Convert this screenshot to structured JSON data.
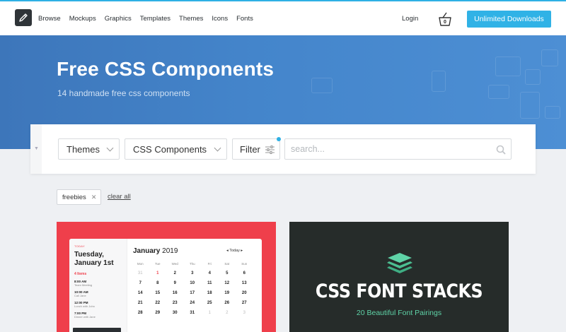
{
  "nav": {
    "items": [
      "Browse",
      "Mockups",
      "Graphics",
      "Templates",
      "Themes",
      "Icons",
      "Fonts"
    ],
    "login": "Login",
    "cart_count": "0",
    "unlimited_label": "Unlimited Downloads"
  },
  "hero": {
    "title": "Free CSS Components",
    "subtitle": "14 handmade free css components"
  },
  "filters": {
    "category": "Themes",
    "subcategory": "CSS Components",
    "filter_label": "Filter",
    "search_placeholder": "search..."
  },
  "tags": {
    "active": "freebies",
    "clear_label": "clear all"
  },
  "cards": [
    {
      "calendar": {
        "today_label": "TODAY",
        "day": "Tuesday,",
        "date": "January 1st",
        "items_label": "4 Items",
        "events": [
          {
            "time": "8:00 AM",
            "name": "Team Meeting"
          },
          {
            "time": "10:00 AM",
            "name": "Call Jane"
          },
          {
            "time": "12:00 PM",
            "name": "Lunch with John"
          },
          {
            "time": "7:00 PM",
            "name": "Dinner with Jane"
          }
        ],
        "month": "January",
        "year": "2019",
        "today_btn": "Today",
        "weekdays": [
          "Mon",
          "Tue",
          "Wed",
          "Thu",
          "Fri",
          "Sat",
          "Sun"
        ],
        "weeks": [
          [
            "31",
            "1",
            "2",
            "3",
            "4",
            "5",
            "6"
          ],
          [
            "7",
            "8",
            "9",
            "10",
            "11",
            "12",
            "13"
          ],
          [
            "14",
            "15",
            "16",
            "17",
            "18",
            "19",
            "20"
          ],
          [
            "21",
            "22",
            "23",
            "24",
            "25",
            "26",
            "27"
          ],
          [
            "28",
            "29",
            "30",
            "31",
            "1",
            "2",
            "3"
          ]
        ]
      }
    },
    {
      "title": "CSS FONT STACKS",
      "subtitle": "20 Beautiful Font Pairings"
    }
  ],
  "colors": {
    "accent": "#2eb0e4",
    "hero": "#4485cb",
    "card1_bg": "#ef3f4b",
    "card2_bg": "#262c2a",
    "card2_accent": "#5fd3a7"
  }
}
